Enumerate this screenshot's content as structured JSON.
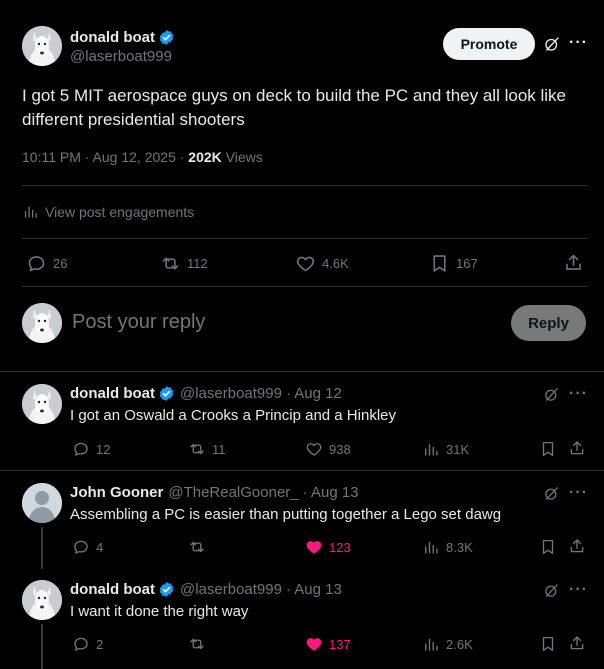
{
  "main_post": {
    "author_name": "donald boat",
    "author_handle": "@laserboat999",
    "text_line1": "I got 5 MIT aerospace guys on deck to build the PC and they all look like",
    "text_line2": "different presidential shooters",
    "time": "10:11 PM · Aug 12, 2025 · ",
    "views_count": "202K",
    "views_label": " Views",
    "promote_label": "Promote",
    "engagements_label": "View post engagements",
    "replies": "26",
    "reposts": "112",
    "likes": "4.6K",
    "bookmarks": "167"
  },
  "reply_box": {
    "placeholder": "Post your reply",
    "button_label": "Reply"
  },
  "replies": [
    {
      "name": "donald boat",
      "handle": "@laserboat999",
      "date": "· Aug 12",
      "text": "I got an Oswald a Crooks a Princip and a Hinkley",
      "replies": "12",
      "reposts": "11",
      "likes": "938",
      "views": "31K",
      "liked": false
    },
    {
      "name": "John Gooner",
      "handle": "@TheRealGooner_",
      "date": "· Aug 13",
      "text": "Assembling a PC is easier than putting together a Lego set dawg",
      "replies": "4",
      "reposts": "",
      "likes": "123",
      "views": "8.3K",
      "liked": true
    },
    {
      "name": "donald boat",
      "handle": "@laserboat999",
      "date": "· Aug 13",
      "text": "I want it done the right way",
      "replies": "2",
      "reposts": "",
      "likes": "137",
      "views": "2.6K",
      "liked": true
    }
  ],
  "colors": {
    "background": "#000000",
    "text": "#e7e9ea",
    "muted": "#71767b",
    "verified": "#1d9bf0",
    "like": "#f91880",
    "divider": "#2f3336"
  }
}
